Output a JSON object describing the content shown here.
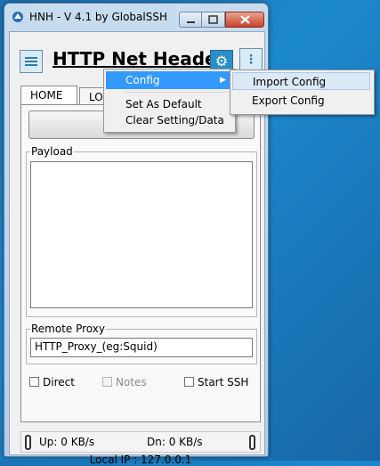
{
  "window": {
    "title": "HNH - V 4.1 by GlobalSSH",
    "app_title": "HTTP Net Header"
  },
  "tabs": [
    {
      "label": "HOME",
      "active": true
    },
    {
      "label": "LO",
      "active": false
    }
  ],
  "payload": {
    "label": "Payload",
    "value": ""
  },
  "remote_proxy": {
    "label": "Remote Proxy",
    "value": "HTTP_Proxy_(eg:Squid)"
  },
  "options": {
    "direct": {
      "label": "Direct",
      "checked": false,
      "enabled": true
    },
    "notes": {
      "label": "Notes",
      "checked": false,
      "enabled": false
    },
    "start_ssh": {
      "label": "Start SSH",
      "checked": false,
      "enabled": true
    }
  },
  "status": {
    "up": "Up: 0 KB/s",
    "dn": "Dn: 0 KB/s",
    "local_ip": "Local IP : 127.0.0.1"
  },
  "context_menu": {
    "items": [
      "Config",
      "Set As Default",
      "Clear Setting/Data"
    ],
    "submenu": [
      "Import Config",
      "Export Config"
    ]
  },
  "colors": {
    "accent": "#3399ff",
    "gear_button": "#2a8fc8",
    "desktop": "#1c88cc"
  }
}
